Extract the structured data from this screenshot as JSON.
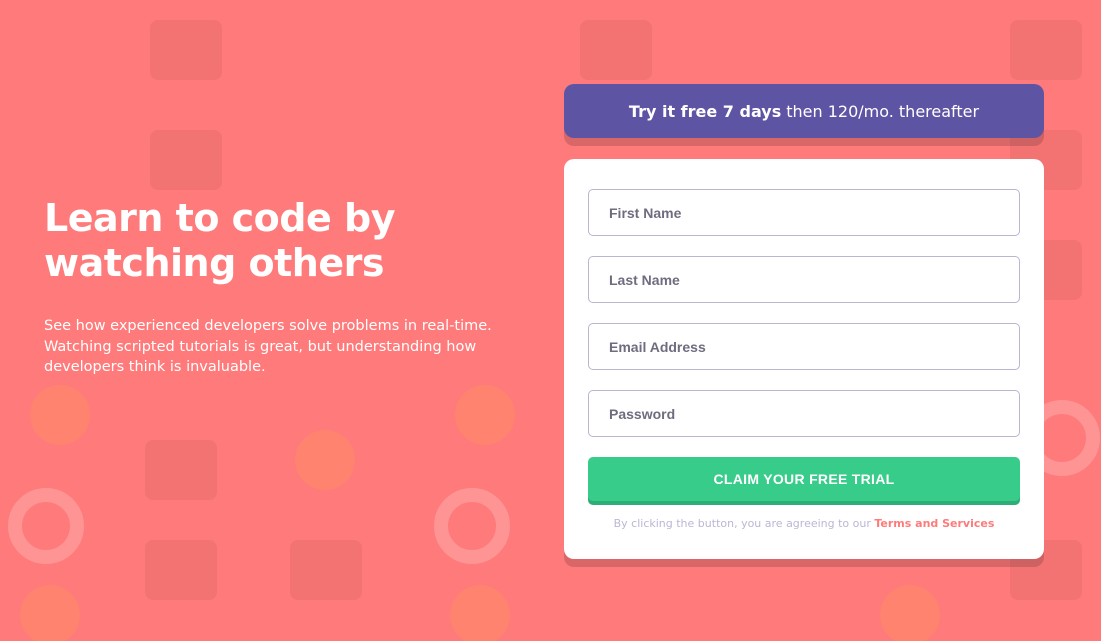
{
  "hero": {
    "headline_line1": "Learn to code by",
    "headline_line2": "watching others",
    "description_line1": "See how experienced developers solve problems in real-time.",
    "description_line2": "Watching scripted tutorials is great, but understanding how",
    "description_line3": "developers think is invaluable."
  },
  "banner": {
    "bold_text": "Try it free 7 days",
    "rest_text": "then 120/mo. thereafter"
  },
  "form": {
    "first_name_placeholder": "First Name",
    "last_name_placeholder": "Last Name",
    "email_placeholder": "Email Address",
    "password_placeholder": "Password",
    "submit_label": "CLAIM YOUR FREE TRIAL",
    "terms_prefix": "By clicking the button, you are agreeing to our",
    "terms_link": "Terms and Services"
  },
  "colors": {
    "background": "#ff7a7a",
    "banner": "#5e54a4",
    "button": "#38cc8b",
    "link": "#ff7a7a"
  }
}
